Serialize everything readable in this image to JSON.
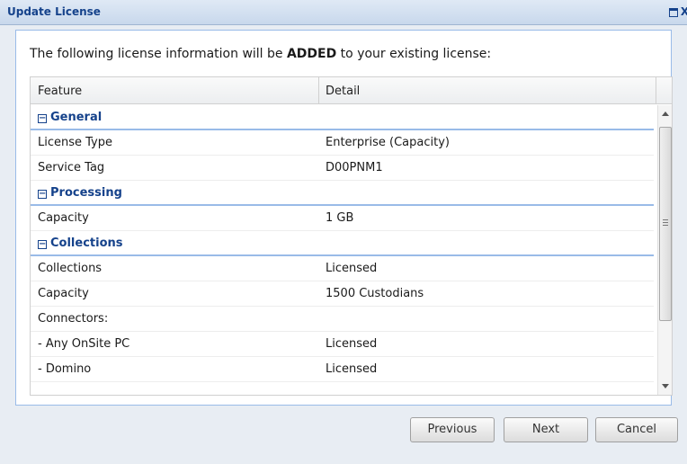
{
  "window": {
    "title": "Update License",
    "maximize_icon": "maximize-icon",
    "close_glyph": "X"
  },
  "intro": {
    "prefix": "The following license information will be ",
    "emphasis": "ADDED",
    "suffix": " to your existing license:"
  },
  "grid": {
    "columns": [
      "Feature",
      "Detail"
    ],
    "groups": [
      {
        "label": "General",
        "rows": [
          {
            "feature": "License Type",
            "detail": "Enterprise (Capacity)"
          },
          {
            "feature": "Service Tag",
            "detail": "D00PNM1"
          }
        ]
      },
      {
        "label": "Processing",
        "rows": [
          {
            "feature": "Capacity",
            "detail": "1 GB"
          }
        ]
      },
      {
        "label": "Collections",
        "rows": [
          {
            "feature": "Collections",
            "detail": "Licensed"
          },
          {
            "feature": "Capacity",
            "detail": "1500 Custodians"
          },
          {
            "feature": "Connectors:",
            "detail": ""
          },
          {
            "feature": "- Any OnSite PC",
            "detail": "Licensed"
          },
          {
            "feature": "- Domino",
            "detail": "Licensed"
          }
        ]
      }
    ],
    "collapse_glyph": "−"
  },
  "buttons": {
    "previous": "Previous",
    "next": "Next",
    "cancel": "Cancel"
  },
  "colors": {
    "accent": "#15428b",
    "group_line": "#99bbe8"
  }
}
